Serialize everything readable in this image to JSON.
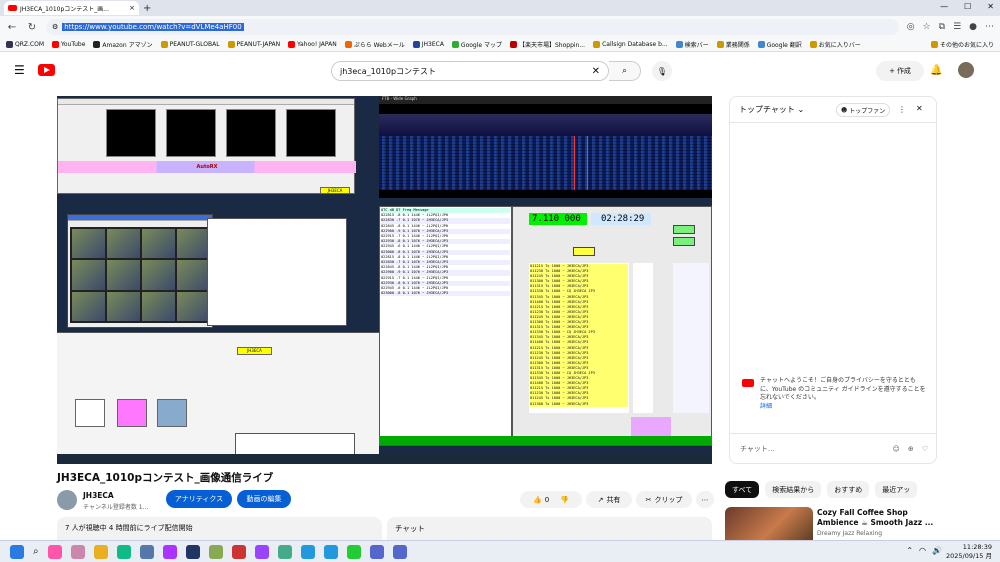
{
  "browser": {
    "tab_title": "JH3ECA_1010pコンテスト_画...",
    "url": "https://www.youtube.com/watch?v=dVLMe4aHF00",
    "bookmarks": [
      "QRZ.COM",
      "YouTube",
      "Amazon アマゾン",
      "PEANUT-GLOBAL",
      "PEANUT-JAPAN",
      "Yahoo! JAPAN",
      "ぷらら Webメール",
      "JH3ECA",
      "Google マップ",
      "【楽天市場】Shoppin...",
      "Callsign Database b...",
      "検索バー",
      "業務関係",
      "Google 翻訳",
      "お気に入りバー"
    ],
    "bookmarks_other": "その他のお気に入り"
  },
  "youtube": {
    "search_query": "jh3eca_1010pコンテスト",
    "create_label": "作成"
  },
  "video_inner": {
    "waterfall_title": "FT8 - Wide Graph",
    "frequency": "7.110 000",
    "time": "02:28:29",
    "autorx": "AutoRX",
    "callsign": "JH3ECA",
    "log_header": "UTC  dB  DT Freq   Message",
    "log_lines": [
      "022815 -8 0.1 1446 ~ JL2PQI/JP0",
      "022830 -7 0.1 1076 ~ JH3ECA/JP3",
      "022845 -8 0.1 1446 ~ JL2PQI/JP0",
      "022900 -9 0.1 1076 ~ JH3ECA/JP3",
      "022915 -7 0.1 1446 ~ JL2PQI/JP0",
      "022930 -8 0.1 1076 ~ JH3ECA/JP3",
      "022945 -6 0.1 1446 ~ JL2PQI/JP0",
      "023000 -8 0.1 1076 ~ JH3ECA/JP3"
    ],
    "rx_lines": [
      "011215 Tx 1000 ~ JH3ECA/JP3",
      "011230 Tx 1000 ~ JH3ECA/JP3",
      "011245 Tx 1000 ~ JH3ECA/JP3",
      "011300 Tx 1000 ~ JH3ECA/JP3",
      "011315 Tx 1000 ~ JH3ECA/JP3",
      "011330 Tx 1000 ~ CQ JH3ECA JP3",
      "011345 Tx 1000 ~ JH3ECA/JP3",
      "011400 Tx 1000 ~ JH3ECA/JP3"
    ]
  },
  "video": {
    "title": "JH3ECA_1010pコンテスト_画像通信ライブ",
    "channel": "JH3ECA",
    "subscribers": "チャンネル登録者数 1...",
    "analytics": "アナリティクス",
    "edit": "動画の編集",
    "likes": "0",
    "share": "共有",
    "clip": "クリップ",
    "info": "7 人が視聴中  4 時間前にライブ配信開始",
    "chat_label": "チャット"
  },
  "chat": {
    "header": "トップチャット",
    "top_fan": "トップファン",
    "welcome": "チャットへようこそ！ご自身のプライバシーを守るとともに、YouTube のコミュニティ ガイドラインを遵守することを忘れないでください。",
    "link": "詳細",
    "placeholder": "チャット..."
  },
  "related": {
    "chips": [
      "すべて",
      "検索結果から",
      "おすすめ",
      "最近アッ"
    ],
    "title": "Cozy Fall Coffee Shop Ambience ☕ Smooth Jazz ...",
    "channel": "Dreamy Jazz Relaxing"
  },
  "taskbar": {
    "time": "11:28:39",
    "date": "2025/09/15 月"
  },
  "colors": {
    "yt_red": "#ff0000",
    "blue": "#065fd4",
    "freq_green": "#00f000"
  }
}
